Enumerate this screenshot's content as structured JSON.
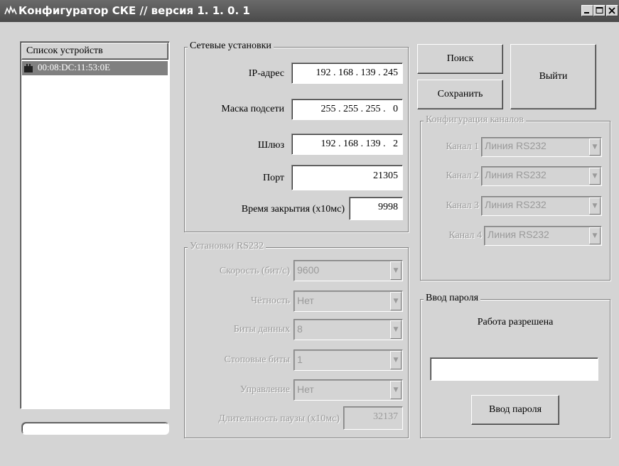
{
  "window": {
    "title": "Конфигуратор СКЕ // версия 1. 1. 0. 1",
    "controls": [
      "minimize-icon",
      "maximize-icon",
      "close-icon"
    ]
  },
  "devices": {
    "header": "Список устройств",
    "items": [
      "00:08:DC:11:53:0E"
    ]
  },
  "network": {
    "legend": "Сетевые установки",
    "ip_label": "IP-адрес",
    "ip_value": "192 . 168 . 139 . 245",
    "mask_label": "Маска подсети",
    "mask_value": "255 . 255 . 255 .   0",
    "gateway_label": "Шлюз",
    "gateway_value": "192 . 168 . 139 .   2",
    "port_label": "Порт",
    "port_value": "21305",
    "close_time_label": "Время закрытия (x10мс)",
    "close_time_value": "9998"
  },
  "rs232": {
    "legend": "Установки RS232",
    "speed_label": "Скорость (бит/с)",
    "speed_value": "9600",
    "parity_label": "Чётность",
    "parity_value": "Нет",
    "data_bits_label": "Биты данных",
    "data_bits_value": "8",
    "stop_bits_label": "Стоповые биты",
    "stop_bits_value": "1",
    "control_label": "Управление",
    "control_value": "Нет",
    "pause_label": "Длительность паузы (x10мс)",
    "pause_value": "32137"
  },
  "buttons": {
    "search": "Поиск",
    "save": "Сохранить",
    "exit": "Выйти",
    "enter_password": "Ввод пароля"
  },
  "channels": {
    "legend": "Конфигурация каналов",
    "items": [
      {
        "label": "Канал 1",
        "value": "Линия RS232"
      },
      {
        "label": "Канал 2",
        "value": "Линия RS232"
      },
      {
        "label": "Канал 3",
        "value": "Линия RS232"
      },
      {
        "label": "Канал 4",
        "value": "Линия RS232"
      }
    ]
  },
  "password": {
    "legend": "Ввод пароля",
    "status": "Работа разрешена",
    "input_value": ""
  },
  "colors": {
    "window_bg": "#d4d4d4",
    "titlebar": "#555555",
    "selection": "#808080",
    "disabled_text": "#9a9a9a"
  }
}
